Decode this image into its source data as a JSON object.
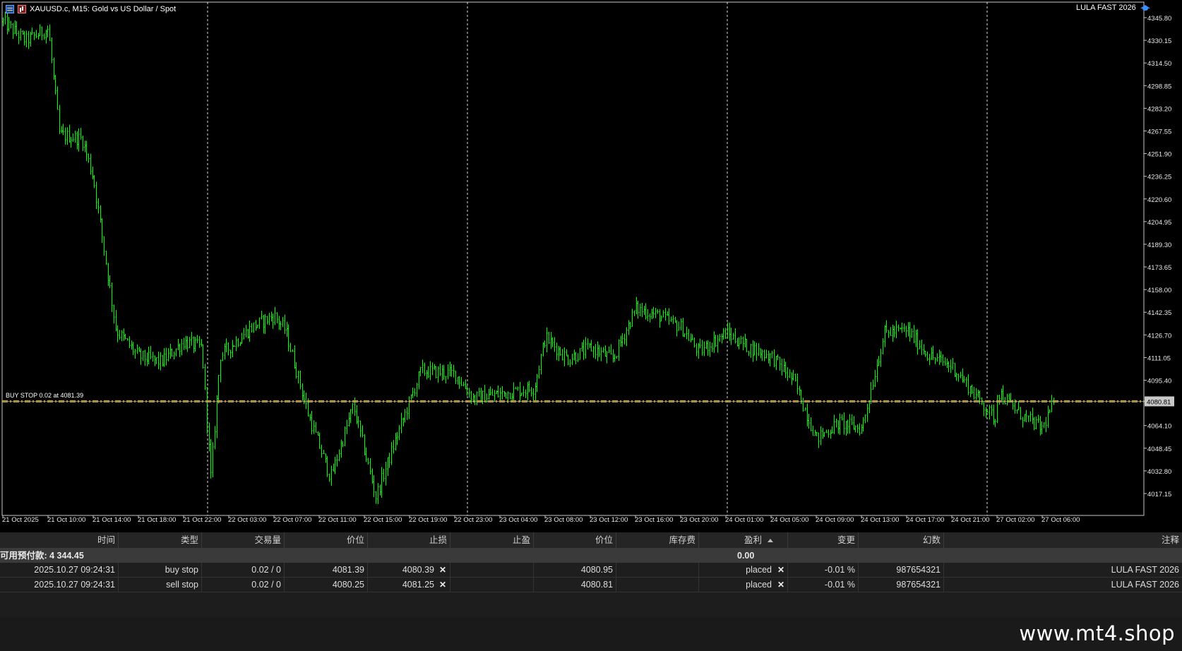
{
  "chart": {
    "symbol_title": "XAUUSD.c, M15:  Gold vs US Dollar / Spot",
    "ea_name": "LULA FAST 2026",
    "ea_icon": "graduation-cap-icon",
    "current_price_label": "4080.81",
    "order_line_label": "BUY STOP 0.02 at 4081.39",
    "colors": {
      "background": "#000000",
      "bars": "#00ff00",
      "order_line": "#c9a227",
      "grid": "#ffffff"
    }
  },
  "chart_data": {
    "type": "candlestick",
    "timeframe": "M15",
    "y_ticks": [
      "4345.80",
      "4330.15",
      "4314.50",
      "4298.85",
      "4283.20",
      "4267.55",
      "4251.90",
      "4236.25",
      "4220.60",
      "4204.95",
      "4189.30",
      "4173.65",
      "4158.00",
      "4142.35",
      "4126.70",
      "4111.05",
      "4095.40",
      "4080.81",
      "4064.10",
      "4048.45",
      "4032.80",
      "4017.15"
    ],
    "x_ticks": [
      "21 Oct 2025",
      "21 Oct 10:00",
      "21 Oct 14:00",
      "21 Oct 18:00",
      "21 Oct 22:00",
      "22 Oct 03:00",
      "22 Oct 07:00",
      "22 Oct 11:00",
      "22 Oct 15:00",
      "22 Oct 19:00",
      "22 Oct 23:00",
      "23 Oct 04:00",
      "23 Oct 08:00",
      "23 Oct 12:00",
      "23 Oct 16:00",
      "23 Oct 20:00",
      "24 Oct 01:00",
      "24 Oct 05:00",
      "24 Oct 09:00",
      "24 Oct 13:00",
      "24 Oct 17:00",
      "24 Oct 21:00",
      "27 Oct 02:00",
      "27 Oct 06:00"
    ],
    "ylim": [
      4010,
      4350
    ],
    "day_separators": [
      "22 Oct",
      "23 Oct",
      "24 Oct",
      "27 Oct"
    ],
    "price_path": [
      {
        "t": "21 Oct 2025",
        "p": 4343
      },
      {
        "t": "21 Oct 08:00",
        "p": 4330
      },
      {
        "t": "21 Oct 10:00",
        "p": 4338
      },
      {
        "t": "21 Oct 11:00",
        "p": 4265
      },
      {
        "t": "21 Oct 13:00",
        "p": 4262
      },
      {
        "t": "21 Oct 14:00",
        "p": 4235
      },
      {
        "t": "21 Oct 16:00",
        "p": 4130
      },
      {
        "t": "21 Oct 18:00",
        "p": 4112
      },
      {
        "t": "21 Oct 20:00",
        "p": 4108
      },
      {
        "t": "21 Oct 22:00",
        "p": 4122
      },
      {
        "t": "22 Oct 00:00",
        "p": 4118
      },
      {
        "t": "22 Oct 01:00",
        "p": 4028
      },
      {
        "t": "22 Oct 02:00",
        "p": 4112
      },
      {
        "t": "22 Oct 05:00",
        "p": 4132
      },
      {
        "t": "22 Oct 07:00",
        "p": 4140
      },
      {
        "t": "22 Oct 08:00",
        "p": 4130
      },
      {
        "t": "22 Oct 10:00",
        "p": 4072
      },
      {
        "t": "22 Oct 12:00",
        "p": 4028
      },
      {
        "t": "22 Oct 14:00",
        "p": 4078
      },
      {
        "t": "22 Oct 16:00",
        "p": 4015
      },
      {
        "t": "22 Oct 18:00",
        "p": 4060
      },
      {
        "t": "22 Oct 20:00",
        "p": 4102
      },
      {
        "t": "22 Oct 23:00",
        "p": 4100
      },
      {
        "t": "23 Oct 01:00",
        "p": 4083
      },
      {
        "t": "23 Oct 04:00",
        "p": 4086
      },
      {
        "t": "23 Oct 07:00",
        "p": 4090
      },
      {
        "t": "23 Oct 08:00",
        "p": 4125
      },
      {
        "t": "23 Oct 10:00",
        "p": 4110
      },
      {
        "t": "23 Oct 12:00",
        "p": 4118
      },
      {
        "t": "23 Oct 14:00",
        "p": 4110
      },
      {
        "t": "23 Oct 16:00",
        "p": 4145
      },
      {
        "t": "23 Oct 18:00",
        "p": 4140
      },
      {
        "t": "23 Oct 20:00",
        "p": 4132
      },
      {
        "t": "23 Oct 22:00",
        "p": 4115
      },
      {
        "t": "24 Oct 01:00",
        "p": 4128
      },
      {
        "t": "24 Oct 03:00",
        "p": 4118
      },
      {
        "t": "24 Oct 05:00",
        "p": 4112
      },
      {
        "t": "24 Oct 07:00",
        "p": 4095
      },
      {
        "t": "24 Oct 09:00",
        "p": 4055
      },
      {
        "t": "24 Oct 11:00",
        "p": 4066
      },
      {
        "t": "24 Oct 13:00",
        "p": 4062
      },
      {
        "t": "24 Oct 15:00",
        "p": 4128
      },
      {
        "t": "24 Oct 17:00",
        "p": 4130
      },
      {
        "t": "24 Oct 19:00",
        "p": 4112
      },
      {
        "t": "24 Oct 21:00",
        "p": 4105
      },
      {
        "t": "27 Oct 00:00",
        "p": 4068
      },
      {
        "t": "27 Oct 02:00",
        "p": 4088
      },
      {
        "t": "27 Oct 04:00",
        "p": 4072
      },
      {
        "t": "27 Oct 06:00",
        "p": 4062
      },
      {
        "t": "27 Oct 07:00",
        "p": 4081
      }
    ]
  },
  "table": {
    "columns": [
      "时间",
      "类型",
      "交易量",
      "价位",
      "止损",
      "止盈",
      "价位",
      "库存费",
      "盈利",
      "变更",
      "幻数",
      "注释"
    ],
    "summary": {
      "label": "可用预付款: 4 344.45",
      "profit": "0.00"
    },
    "rows": [
      {
        "time": "2025.10.27 09:24:31",
        "type": "buy stop",
        "volume": "0.02 / 0",
        "price": "4081.39",
        "sl": "4080.39",
        "tp": "",
        "cur_price": "4080.95",
        "swap": "",
        "profit": "placed",
        "change": "-0.01 %",
        "magic": "987654321",
        "comment": "LULA FAST 2026"
      },
      {
        "time": "2025.10.27 09:24:31",
        "type": "sell stop",
        "volume": "0.02 / 0",
        "price": "4080.25",
        "sl": "4081.25",
        "tp": "",
        "cur_price": "4080.81",
        "swap": "",
        "profit": "placed",
        "change": "-0.01 %",
        "magic": "987654321",
        "comment": "LULA FAST 2026"
      }
    ]
  },
  "watermark": "www.mt4.shop"
}
